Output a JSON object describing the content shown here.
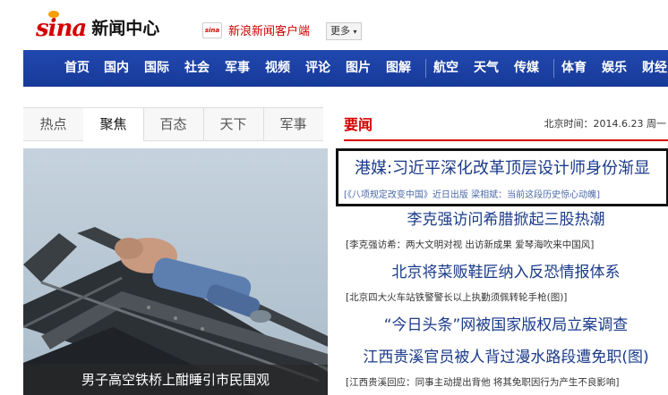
{
  "header": {
    "logo_brand": "sina",
    "logo_title": "新闻中心",
    "client_icon_text": "sina",
    "client_link": "新浪新闻客户端",
    "more_label": "更多"
  },
  "nav": {
    "items": [
      "首页",
      "国内",
      "国际",
      "社会",
      "军事",
      "视频",
      "评论",
      "图片",
      "图解",
      "航空",
      "天气",
      "传媒",
      "体育",
      "娱乐",
      "财经"
    ]
  },
  "tabs": {
    "items": [
      "热点",
      "聚焦",
      "百态",
      "天下",
      "军事"
    ],
    "active": "聚焦"
  },
  "focus": {
    "caption": "男子高空铁桥上酣睡引市民围观"
  },
  "news": {
    "section_title": "要闻",
    "date_text": "北京时间：2014.6.23 周一",
    "headline": "港媒:习近平深化改革顶层设计师身份渐显",
    "headline_sub": "[《八项规定改变中国》近日出版  梁相斌：当前这段历史惊心动魄]",
    "items": [
      {
        "title": "李克强访问希腊掀起三股热潮",
        "sub": "[李克强访希：两大文明对视 出访新成果 爱琴海吹来中国风]"
      },
      {
        "title": "北京将菜贩鞋匠纳入反恐情报体系",
        "sub": "[北京四大火车站铁警警长以上执勤须佩转轮手枪(图)]"
      },
      {
        "title": "“今日头条”网被国家版权局立案调查",
        "sub": ""
      },
      {
        "title": "江西贵溪官员被人背过漫水路段遭免职(图)",
        "sub": "[江西贵溪回应：同事主动提出背他 将其免职因行为产生不良影响]"
      }
    ]
  },
  "colors": {
    "brand_red": "#d40000",
    "nav_blue": "#1a3ea0",
    "link_blue": "#1a3a8a"
  }
}
